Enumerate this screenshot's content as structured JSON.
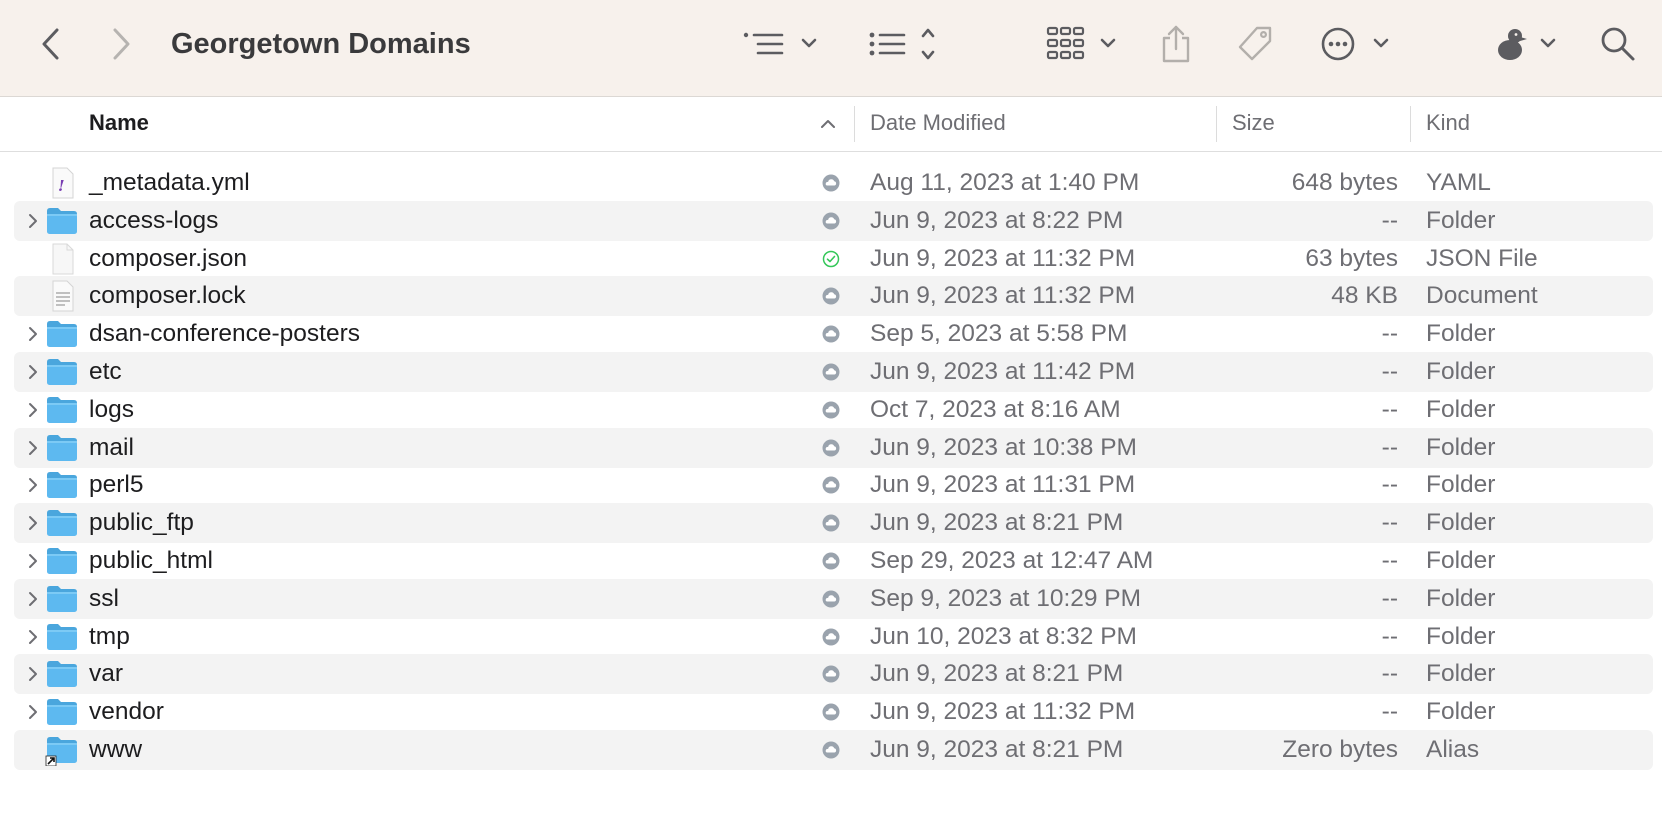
{
  "window": {
    "title": "Georgetown Domains"
  },
  "toolbar": {
    "icons": [
      "chevron-left-icon",
      "chevron-right-icon",
      "group-by-icon",
      "list-view-icon",
      "icon-grid-icon",
      "share-icon",
      "tag-icon",
      "more-actions-icon",
      "profile-icon",
      "search-icon"
    ]
  },
  "columns": {
    "name": "Name",
    "date": "Date Modified",
    "size": "Size",
    "kind": "Kind"
  },
  "colors": {
    "folder": "#5db9f0",
    "sync_synced": "#34c759",
    "sync_cloud": "#9aa3ad",
    "toolbar_bg": "#f7f1ec"
  },
  "files": [
    {
      "name": "_metadata.yml",
      "date": "Aug 11, 2023 at 1:40 PM",
      "size": "648 bytes",
      "kind": "YAML",
      "icon": "yaml-file-icon",
      "expandable": false,
      "sync": "cloud"
    },
    {
      "name": "access-logs",
      "date": "Jun 9, 2023 at 8:22 PM",
      "size": "--",
      "kind": "Folder",
      "icon": "folder-icon",
      "expandable": true,
      "sync": "cloud"
    },
    {
      "name": "composer.json",
      "date": "Jun 9, 2023 at 11:32 PM",
      "size": "63 bytes",
      "kind": "JSON File",
      "icon": "json-file-icon",
      "expandable": false,
      "sync": "synced"
    },
    {
      "name": "composer.lock",
      "date": "Jun 9, 2023 at 11:32 PM",
      "size": "48 KB",
      "kind": "Document",
      "icon": "document-icon",
      "expandable": false,
      "sync": "cloud"
    },
    {
      "name": "dsan-conference-posters",
      "date": "Sep 5, 2023 at 5:58 PM",
      "size": "--",
      "kind": "Folder",
      "icon": "folder-icon",
      "expandable": true,
      "sync": "cloud"
    },
    {
      "name": "etc",
      "date": "Jun 9, 2023 at 11:42 PM",
      "size": "--",
      "kind": "Folder",
      "icon": "folder-icon",
      "expandable": true,
      "sync": "cloud"
    },
    {
      "name": "logs",
      "date": "Oct 7, 2023 at 8:16 AM",
      "size": "--",
      "kind": "Folder",
      "icon": "folder-icon",
      "expandable": true,
      "sync": "cloud"
    },
    {
      "name": "mail",
      "date": "Jun 9, 2023 at 10:38 PM",
      "size": "--",
      "kind": "Folder",
      "icon": "folder-icon",
      "expandable": true,
      "sync": "cloud"
    },
    {
      "name": "perl5",
      "date": "Jun 9, 2023 at 11:31 PM",
      "size": "--",
      "kind": "Folder",
      "icon": "folder-icon",
      "expandable": true,
      "sync": "cloud"
    },
    {
      "name": "public_ftp",
      "date": "Jun 9, 2023 at 8:21 PM",
      "size": "--",
      "kind": "Folder",
      "icon": "folder-icon",
      "expandable": true,
      "sync": "cloud"
    },
    {
      "name": "public_html",
      "date": "Sep 29, 2023 at 12:47 AM",
      "size": "--",
      "kind": "Folder",
      "icon": "folder-icon",
      "expandable": true,
      "sync": "cloud"
    },
    {
      "name": "ssl",
      "date": "Sep 9, 2023 at 10:29 PM",
      "size": "--",
      "kind": "Folder",
      "icon": "folder-icon",
      "expandable": true,
      "sync": "cloud"
    },
    {
      "name": "tmp",
      "date": "Jun 10, 2023 at 8:32 PM",
      "size": "--",
      "kind": "Folder",
      "icon": "folder-icon",
      "expandable": true,
      "sync": "cloud"
    },
    {
      "name": "var",
      "date": "Jun 9, 2023 at 8:21 PM",
      "size": "--",
      "kind": "Folder",
      "icon": "folder-icon",
      "expandable": true,
      "sync": "cloud"
    },
    {
      "name": "vendor",
      "date": "Jun 9, 2023 at 11:32 PM",
      "size": "--",
      "kind": "Folder",
      "icon": "folder-icon",
      "expandable": true,
      "sync": "cloud"
    },
    {
      "name": "www",
      "date": "Jun 9, 2023 at 8:21 PM",
      "size": "Zero bytes",
      "kind": "Alias",
      "icon": "folder-alias-icon",
      "expandable": false,
      "sync": "cloud"
    }
  ]
}
